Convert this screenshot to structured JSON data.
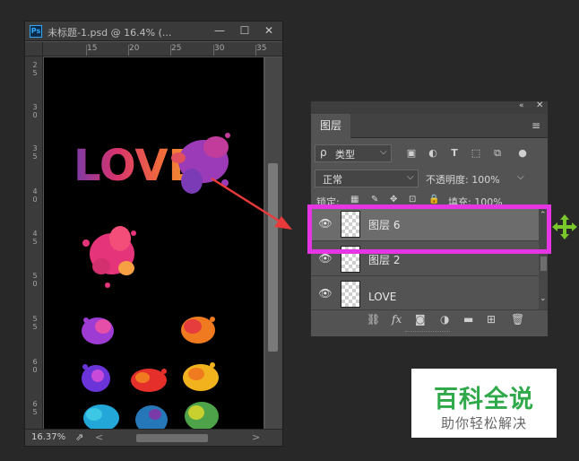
{
  "document_window": {
    "app_badge": "Ps",
    "title": "未标题-1.psd @ 16.4% (...",
    "minimize_glyph": "—",
    "maximize_glyph": "☐",
    "close_glyph": "✕",
    "ruler_h_ticks": [
      "15",
      "20",
      "25",
      "30",
      "35"
    ],
    "ruler_v_ticks": [
      "2\n5",
      "3\n0",
      "3\n5",
      "4\n0",
      "4\n5",
      "5\n0",
      "5\n5",
      "6\n0",
      "6\n5"
    ],
    "canvas_text": "LOVE",
    "zoom": "16.37%",
    "scroll_left_glyph": "<",
    "scroll_right_glyph": ">"
  },
  "layers_panel": {
    "collapse_glyph": "«",
    "close_glyph": "✕",
    "tab_label": "图层",
    "menu_glyph": "≡",
    "filter": {
      "search_glyph": "ρ",
      "value": "类型",
      "chevron": "⌵"
    },
    "filter_icons": [
      "pixel-filter-icon",
      "adjustment-filter-icon",
      "type-filter-icon",
      "shape-filter-icon",
      "smart-object-filter-icon",
      "filter-toggle-icon"
    ],
    "blend_mode": {
      "value": "正常",
      "chevron": "⌵"
    },
    "opacity": {
      "label": "不透明度:",
      "value": "100%",
      "chevron": "⌵"
    },
    "lock": {
      "label": "锁定:",
      "fill_label": "填充:",
      "fill_value": "100%"
    },
    "layers": [
      {
        "name": "图层 6",
        "selected": true
      },
      {
        "name": "图层 2",
        "selected": false
      },
      {
        "name": "LOVE",
        "selected": false
      }
    ],
    "footer_icons": [
      "link-layers-icon",
      "fx-icon",
      "mask-icon",
      "adjustment-layer-icon",
      "folder-icon",
      "new-layer-icon",
      "trash-icon"
    ],
    "fx_label": "fx"
  },
  "colors": {
    "highlight": "#e535e4",
    "arrow": "#e83a3a",
    "move_cursor": "#79c72a",
    "watermark_green": "#2fa94a"
  },
  "watermark": {
    "title": "百科全说",
    "subtitle": "助你轻松解决"
  }
}
